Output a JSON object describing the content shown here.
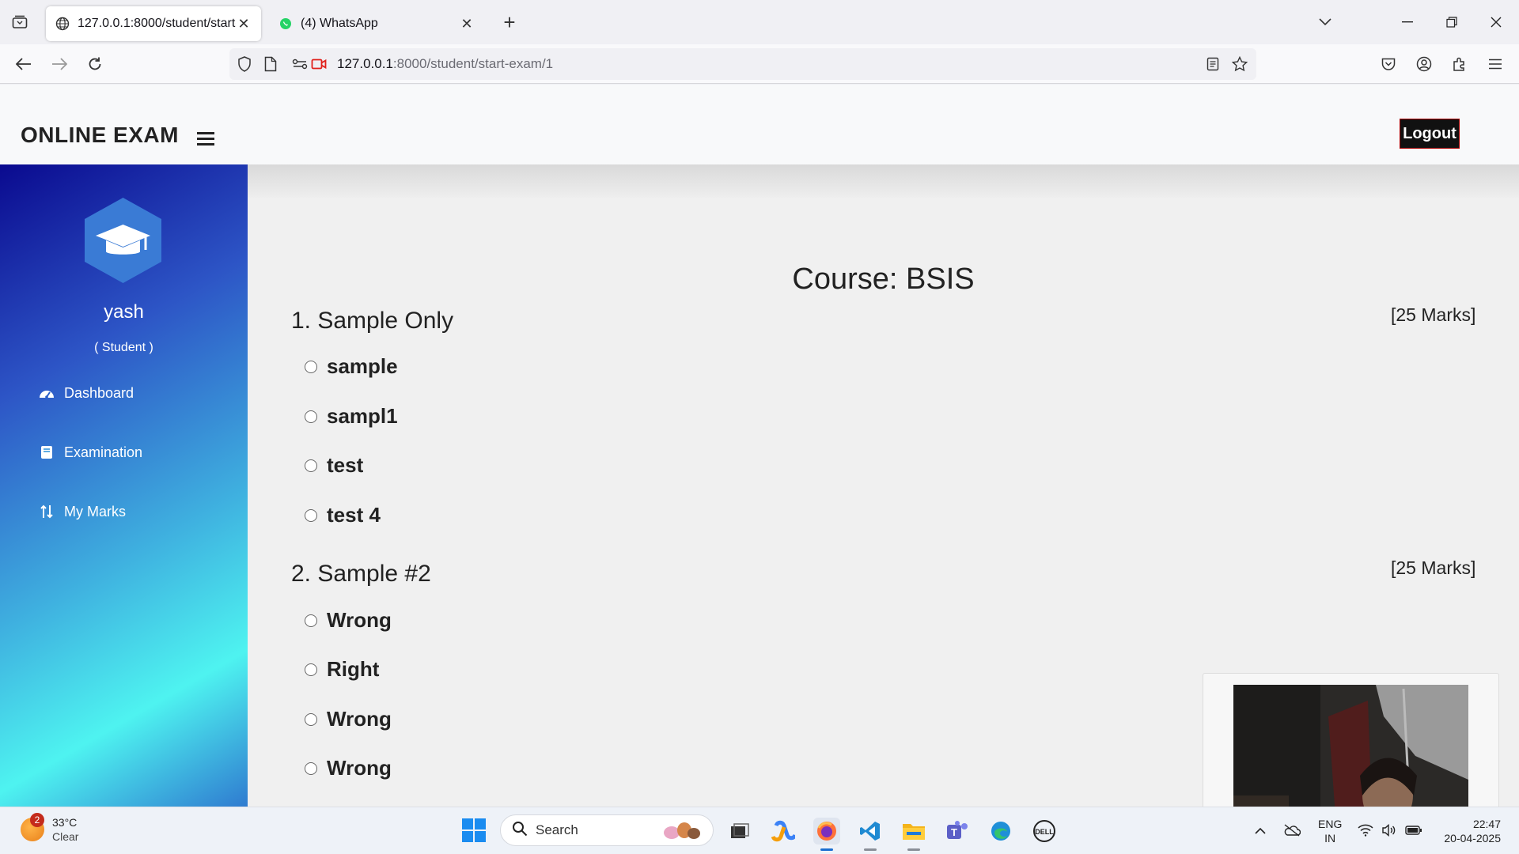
{
  "browser": {
    "tabs": [
      {
        "title": "127.0.0.1:8000/student/start-exam/1",
        "active": true
      },
      {
        "title": "(4) WhatsApp",
        "active": false
      }
    ],
    "url_host": "127.0.0.1",
    "url_path": ":8000/student/start-exam/1"
  },
  "header": {
    "brand": "ONLINE EXAM",
    "logout_label": "Logout"
  },
  "sidebar": {
    "user_name": "yash",
    "user_role": "( Student )",
    "items": [
      {
        "label": "Dashboard",
        "icon": "speedometer-icon"
      },
      {
        "label": "Examination",
        "icon": "book-icon"
      },
      {
        "label": "My Marks",
        "icon": "sort-icon"
      }
    ]
  },
  "exam": {
    "course_title": "Course: BSIS",
    "questions": [
      {
        "title": "1. Sample Only",
        "marks": "[25 Marks]",
        "options": [
          "sample",
          "sampl1",
          "test",
          "test 4"
        ]
      },
      {
        "title": "2. Sample #2",
        "marks": "[25 Marks]",
        "options": [
          "Wrong",
          "Right",
          "Wrong",
          "Wrong"
        ]
      }
    ]
  },
  "taskbar": {
    "weather_temp": "33°C",
    "weather_desc": "Clear",
    "weather_badge": "2",
    "search_placeholder": "Search",
    "lang_top": "ENG",
    "lang_bottom": "IN",
    "time": "22:47",
    "date": "20-04-2025"
  },
  "colors": {
    "logout_bg": "#111111",
    "sidebar_gradient_start": "#0a0a8f",
    "sidebar_gradient_mid": "#4ef3f0",
    "avatar_hex": "#3a7bd5"
  }
}
